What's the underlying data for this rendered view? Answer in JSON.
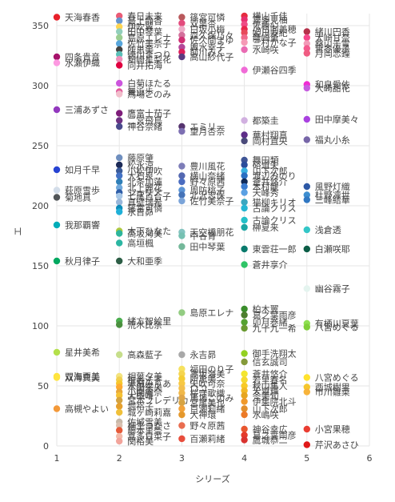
{
  "chart_data": {
    "type": "scatter",
    "xlabel": "シリーズ",
    "ylabel": "エ",
    "xlim": [
      1,
      6
    ],
    "ylim": [
      0,
      360
    ],
    "xticks": [
      1,
      2,
      3,
      4,
      5,
      6
    ],
    "yticks": [
      0,
      50,
      100,
      150,
      200,
      250,
      300,
      350
    ],
    "grid": true,
    "points": [
      {
        "x": 1,
        "y": 357,
        "label": "天海春香",
        "color": "#e8202a"
      },
      {
        "x": 1,
        "y": 324,
        "label": "四条貴音",
        "color": "#a6126a"
      },
      {
        "x": 1,
        "y": 319,
        "label": "水瀬伊織",
        "color": "#fd99e1"
      },
      {
        "x": 1,
        "y": 280,
        "label": "三浦あずさ",
        "color": "#9238be"
      },
      {
        "x": 1,
        "y": 230,
        "label": "如月千早",
        "color": "#2743d2"
      },
      {
        "x": 1,
        "y": 213,
        "label": "萩原雪歩",
        "color": "#d3dde9"
      },
      {
        "x": 1,
        "y": 207,
        "label": "菊地真",
        "color": "#515558"
      },
      {
        "x": 1,
        "y": 184,
        "label": "我那覇響",
        "color": "#01adb9"
      },
      {
        "x": 1,
        "y": 154,
        "label": "秋月律子",
        "color": "#01a860"
      },
      {
        "x": 1,
        "y": 78,
        "label": "星井美希",
        "color": "#b4e04b"
      },
      {
        "x": 1,
        "y": 58,
        "label": "双海亜美",
        "color": "#ffe43f"
      },
      {
        "x": 1,
        "y": 57,
        "label": "双海真美",
        "color": "#ffe43f"
      },
      {
        "x": 1,
        "y": 31,
        "label": "高槻やよい",
        "color": "#f39939"
      },
      {
        "x": 2,
        "y": 358,
        "label": "春日未来",
        "color": "#ea5b76"
      },
      {
        "x": 2,
        "y": 354,
        "label": "最上静香",
        "color": "#6495cf"
      },
      {
        "x": 2,
        "y": 349,
        "label": "伊吹翼",
        "color": "#fed552"
      },
      {
        "x": 2,
        "y": 345,
        "label": "田中琴葉",
        "color": "#92cfbb"
      },
      {
        "x": 2,
        "y": 340,
        "label": "島原エレナ",
        "color": "#9bce92"
      },
      {
        "x": 2,
        "y": 335,
        "label": "佐竹美奈子",
        "color": "#58a6dc"
      },
      {
        "x": 2,
        "y": 330,
        "label": "所恵美",
        "color": "#454341"
      },
      {
        "x": 2,
        "y": 326,
        "label": "徳川まつり",
        "color": "#5abfb7"
      },
      {
        "x": 2,
        "y": 322,
        "label": "箱崎星梨花",
        "color": "#ed90ba"
      },
      {
        "x": 2,
        "y": 317,
        "label": "向井拓海",
        "color": "#e0003f"
      },
      {
        "x": 2,
        "y": 302,
        "label": "白菊ほたる",
        "color": "#cc55dd"
      },
      {
        "x": 2,
        "y": 295,
        "label": "舞浜歩",
        "color": "#e25a9b"
      },
      {
        "x": 2,
        "y": 293,
        "label": "馬場このみ",
        "color": "#f1becb"
      },
      {
        "x": 2,
        "y": 277,
        "label": "鷹富士茄子",
        "color": "#7e1d7a"
      },
      {
        "x": 2,
        "y": 271,
        "label": "二宮飛鳥",
        "color": "#6e3182"
      },
      {
        "x": 2,
        "y": 266,
        "label": "神谷奈緒",
        "color": "#4a4a8c"
      },
      {
        "x": 2,
        "y": 240,
        "label": "藤原肇",
        "color": "#6f8fbf"
      },
      {
        "x": 2,
        "y": 234,
        "label": "松永涼",
        "color": "#1d2b58"
      },
      {
        "x": 2,
        "y": 229,
        "label": "小松伊吹",
        "color": "#3a5a98"
      },
      {
        "x": 2,
        "y": 225,
        "label": "大石泉",
        "color": "#4472c4"
      },
      {
        "x": 2,
        "y": 220,
        "label": "北条加蓮",
        "color": "#2f7fb8"
      },
      {
        "x": 2,
        "y": 215,
        "label": "北上麗花",
        "color": "#6fa8dc"
      },
      {
        "x": 2,
        "y": 211,
        "label": "ジュリア",
        "color": "#2e5da8"
      },
      {
        "x": 2,
        "y": 208,
        "label": "七尾百合子",
        "color": "#a7c7e7"
      },
      {
        "x": 2,
        "y": 203,
        "label": "真壁瑞希",
        "color": "#99b6d9"
      },
      {
        "x": 2,
        "y": 198,
        "label": "篠宮可憐",
        "color": "#0f8cb9"
      },
      {
        "x": 2,
        "y": 195,
        "label": "永吉昴",
        "color": "#1fb0d8"
      },
      {
        "x": 2,
        "y": 179,
        "label": "木下ひなた",
        "color": "#aec93f"
      },
      {
        "x": 2,
        "y": 177,
        "label": "高坂海美",
        "color": "#2db59c"
      },
      {
        "x": 2,
        "y": 169,
        "label": "高垣楓",
        "color": "#2bb6a2"
      },
      {
        "x": 2,
        "y": 154,
        "label": "大和亜季",
        "color": "#2d5e46"
      },
      {
        "x": 2,
        "y": 104,
        "label": "緒方智絵里",
        "color": "#4caf50"
      },
      {
        "x": 2,
        "y": 101,
        "label": "荒木比奈",
        "color": "#4a8f3e"
      },
      {
        "x": 2,
        "y": 76,
        "label": "高森藍子",
        "color": "#c6de8b"
      },
      {
        "x": 2,
        "y": 58,
        "label": "相葉夕美",
        "color": "#f3e37f"
      },
      {
        "x": 2,
        "y": 55,
        "label": "椎名法子",
        "color": "#f0d050"
      },
      {
        "x": 2,
        "y": 52,
        "label": "赤城みりあ",
        "color": "#f7c72d"
      },
      {
        "x": 2,
        "y": 49,
        "label": "本田未央",
        "color": "#ffaa30"
      },
      {
        "x": 2,
        "y": 45,
        "label": "小関麗奈",
        "color": "#e8a838"
      },
      {
        "x": 2,
        "y": 42,
        "label": "大槻唯",
        "color": "#f6c233"
      },
      {
        "x": 2,
        "y": 38,
        "label": "宮本フレデリカ",
        "color": "#d4a33f"
      },
      {
        "x": 2,
        "y": 33,
        "label": "堀裕子",
        "color": "#e5a02e"
      },
      {
        "x": 2,
        "y": 28,
        "label": "城ヶ崎莉嘉",
        "color": "#f0c03a"
      },
      {
        "x": 2,
        "y": 20,
        "label": "佐城雪美",
        "color": "#c7b8a8"
      },
      {
        "x": 2,
        "y": 17,
        "label": "桐生つかさ",
        "color": "#d9c0b0"
      },
      {
        "x": 2,
        "y": 13,
        "label": "藤本里奈",
        "color": "#e65a39"
      },
      {
        "x": 2,
        "y": 8,
        "label": "喜多日菜子",
        "color": "#f3b9a8"
      },
      {
        "x": 2,
        "y": 4,
        "label": "関裕美",
        "color": "#f2a49b"
      },
      {
        "x": 3,
        "y": 357,
        "label": "篠宮可憐",
        "color": "#b9595c"
      },
      {
        "x": 3,
        "y": 352,
        "label": "双葉杏",
        "color": "#e34a7d"
      },
      {
        "x": 3,
        "y": 347,
        "label": "白坂小梅",
        "color": "#eeaac7"
      },
      {
        "x": 3,
        "y": 342,
        "label": "森久保乃々",
        "color": "#d36f9b"
      },
      {
        "x": 3,
        "y": 338,
        "label": "佐久間まゆ",
        "color": "#d12f73"
      },
      {
        "x": 3,
        "y": 332,
        "label": "輿水幸子",
        "color": "#b3489a"
      },
      {
        "x": 3,
        "y": 328,
        "label": "前川みく",
        "color": "#dd1f5b"
      },
      {
        "x": 3,
        "y": 324,
        "label": "高山紗代子",
        "color": "#5c3a80"
      },
      {
        "x": 3,
        "y": 266,
        "label": "エミリー",
        "color": "#55346e"
      },
      {
        "x": 3,
        "y": 262,
        "label": "望月杏奈",
        "color": "#7d6fb2"
      },
      {
        "x": 3,
        "y": 233,
        "label": "豊川風花",
        "color": "#7d7db8"
      },
      {
        "x": 3,
        "y": 225,
        "label": "横山奈緒",
        "color": "#5468b1"
      },
      {
        "x": 3,
        "y": 220,
        "label": "野々原茜",
        "color": "#4a6cc0"
      },
      {
        "x": 3,
        "y": 213,
        "label": "周防桃子",
        "color": "#5b93d5"
      },
      {
        "x": 3,
        "y": 209,
        "label": "北沢志保",
        "color": "#4573b8"
      },
      {
        "x": 3,
        "y": 204,
        "label": "佐竹美奈子",
        "color": "#7ba4d9"
      },
      {
        "x": 3,
        "y": 178,
        "label": "天空橋朋花",
        "color": "#84c4c0"
      },
      {
        "x": 3,
        "y": 175,
        "label": "中谷育",
        "color": "#76c1b2"
      },
      {
        "x": 3,
        "y": 166,
        "label": "田中琴葉",
        "color": "#74b89a"
      },
      {
        "x": 3,
        "y": 111,
        "label": "島原エレナ",
        "color": "#93cc82"
      },
      {
        "x": 3,
        "y": 76,
        "label": "永吉昴",
        "color": "#a8a8a8"
      },
      {
        "x": 3,
        "y": 64,
        "label": "福田のり子",
        "color": "#f6e15f"
      },
      {
        "x": 3,
        "y": 60,
        "label": "高坂海美",
        "color": "#f5d54f"
      },
      {
        "x": 3,
        "y": 56,
        "label": "所恵美",
        "color": "#f4cd33"
      },
      {
        "x": 3,
        "y": 52,
        "label": "矢吹可奈",
        "color": "#f7c843"
      },
      {
        "x": 3,
        "y": 48,
        "label": "ロコ",
        "color": "#f3bf4c"
      },
      {
        "x": 3,
        "y": 44,
        "label": "桜守歌織",
        "color": "#f0b84a"
      },
      {
        "x": 3,
        "y": 40,
        "label": "馬場このみ",
        "color": "#e0a648"
      },
      {
        "x": 3,
        "y": 36,
        "label": "宮尾美也",
        "color": "#d6a343"
      },
      {
        "x": 3,
        "y": 31,
        "label": "百瀬莉緒",
        "color": "#f2a23a"
      },
      {
        "x": 3,
        "y": 26,
        "label": "大神環",
        "color": "#e4982d"
      },
      {
        "x": 3,
        "y": 17,
        "label": "野々原茜",
        "color": "#e96d50"
      },
      {
        "x": 3,
        "y": 6,
        "label": "百瀬莉緒",
        "color": "#e84d3c"
      },
      {
        "x": 4,
        "y": 358,
        "label": "横山千佳",
        "color": "#e62b3f"
      },
      {
        "x": 4,
        "y": 355,
        "label": "喜多見柚",
        "color": "#e72f6e"
      },
      {
        "x": 4,
        "y": 351,
        "label": "佐藤心",
        "color": "#ee4b85"
      },
      {
        "x": 4,
        "y": 347,
        "label": "小日向美穂",
        "color": "#e8254b"
      },
      {
        "x": 4,
        "y": 344,
        "label": "姫川友紀",
        "color": "#e74a5a"
      },
      {
        "x": 4,
        "y": 340,
        "label": "龍崎薫",
        "color": "#f06a8b"
      },
      {
        "x": 4,
        "y": 336,
        "label": "三村かな子",
        "color": "#f59ab6"
      },
      {
        "x": 4,
        "y": 330,
        "label": "水崎咲",
        "color": "#e96bb3"
      },
      {
        "x": 4,
        "y": 313,
        "label": "伊瀬谷四季",
        "color": "#f06bd7"
      },
      {
        "x": 4,
        "y": 271,
        "label": "都築圭",
        "color": "#d1b0e0"
      },
      {
        "x": 4,
        "y": 259,
        "label": "華村翔真",
        "color": "#5e2e88"
      },
      {
        "x": 4,
        "y": 254,
        "label": "岡村直央",
        "color": "#4a4a7a"
      },
      {
        "x": 4,
        "y": 238,
        "label": "舞田類",
        "color": "#3f5596"
      },
      {
        "x": 4,
        "y": 234,
        "label": "硲道夫",
        "color": "#2b4c9b"
      },
      {
        "x": 4,
        "y": 229,
        "label": "山下次郎",
        "color": "#39b0e0"
      },
      {
        "x": 4,
        "y": 225,
        "label": "渡辺みのり",
        "color": "#2b6fc2"
      },
      {
        "x": 4,
        "y": 220,
        "label": "蒼井悠介",
        "color": "#102a58"
      },
      {
        "x": 4,
        "y": 216,
        "label": "木村龍",
        "color": "#3b7bcf"
      },
      {
        "x": 4,
        "y": 211,
        "label": "天峰秀",
        "color": "#5aa0e3"
      },
      {
        "x": 4,
        "y": 203,
        "label": "猫柳キリオ",
        "color": "#3aa6c0"
      },
      {
        "x": 4,
        "y": 198,
        "label": "古論クリス",
        "color": "#25b5d3"
      },
      {
        "x": 4,
        "y": 188,
        "label": "古論クリス",
        "color": "#23c0c9"
      },
      {
        "x": 4,
        "y": 182,
        "label": "榊夏来",
        "color": "#1ba6a4"
      },
      {
        "x": 4,
        "y": 164,
        "label": "東雲荘一郎",
        "color": "#087a6c"
      },
      {
        "x": 4,
        "y": 151,
        "label": "蒼井享介",
        "color": "#2ec466"
      },
      {
        "x": 4,
        "y": 114,
        "label": "柏木翼",
        "color": "#3a8d2b"
      },
      {
        "x": 4,
        "y": 109,
        "label": "葛之葉雨彦",
        "color": "#4d7e2e"
      },
      {
        "x": 4,
        "y": 103,
        "label": "卯月巻緒",
        "color": "#55a230"
      },
      {
        "x": 4,
        "y": 98,
        "label": "九十九一希",
        "color": "#6a9a30"
      },
      {
        "x": 4,
        "y": 77,
        "label": "御手洗翔太",
        "color": "#93d121"
      },
      {
        "x": 4,
        "y": 70,
        "label": "信玄誠司",
        "color": "#859a3a"
      },
      {
        "x": 4,
        "y": 60,
        "label": "蒼井悠介",
        "color": "#f3e630"
      },
      {
        "x": 4,
        "y": 55,
        "label": "若里春名",
        "color": "#f6d930"
      },
      {
        "x": 4,
        "y": 50,
        "label": "秋山隼人",
        "color": "#f8ca26"
      },
      {
        "x": 4,
        "y": 46,
        "label": "天道輝",
        "color": "#f3b925"
      },
      {
        "x": 4,
        "y": 42,
        "label": "冬美旬",
        "color": "#e6a520"
      },
      {
        "x": 4,
        "y": 37,
        "label": "伊集院北斗",
        "color": "#f0992a"
      },
      {
        "x": 4,
        "y": 31,
        "label": "山下次郎",
        "color": "#e28f2c"
      },
      {
        "x": 4,
        "y": 26,
        "label": "水嶋咲",
        "color": "#ec7a28"
      },
      {
        "x": 4,
        "y": 14,
        "label": "神谷幸広",
        "color": "#e8562f"
      },
      {
        "x": 4,
        "y": 9,
        "label": "葛之葉雨彦",
        "color": "#e43a2b"
      },
      {
        "x": 4,
        "y": 5,
        "label": "鷹城恭二",
        "color": "#d9322f"
      },
      {
        "x": 5,
        "y": 345,
        "label": "緒川円香",
        "color": "#b5314a"
      },
      {
        "x": 5,
        "y": 340,
        "label": "大崎甘奈",
        "color": "#f6478a"
      },
      {
        "x": 5,
        "y": 335,
        "label": "桑山千雪",
        "color": "#f29ab7"
      },
      {
        "x": 5,
        "y": 331,
        "label": "黛冬優子",
        "color": "#f45a8f"
      },
      {
        "x": 5,
        "y": 327,
        "label": "月岡恋鐘",
        "color": "#f05c82"
      },
      {
        "x": 5,
        "y": 301,
        "label": "和泉愛依",
        "color": "#f12bd2"
      },
      {
        "x": 5,
        "y": 298,
        "label": "大崎甜花",
        "color": "#c65de0"
      },
      {
        "x": 5,
        "y": 272,
        "label": "田中摩美々",
        "color": "#a941e0"
      },
      {
        "x": 5,
        "y": 255,
        "label": "福丸小糸",
        "color": "#7766a8"
      },
      {
        "x": 5,
        "y": 216,
        "label": "風野灯織",
        "color": "#2d58a5"
      },
      {
        "x": 5,
        "y": 209,
        "label": "杜野凛世",
        "color": "#3e8ed0"
      },
      {
        "x": 5,
        "y": 205,
        "label": "三峰結華",
        "color": "#3077c2"
      },
      {
        "x": 5,
        "y": 180,
        "label": "浅倉透",
        "color": "#33c6c7"
      },
      {
        "x": 5,
        "y": 164,
        "label": "白瀬咲耶",
        "color": "#0b5d46"
      },
      {
        "x": 5,
        "y": 131,
        "label": "幽谷霧子",
        "color": "#e4f4ef"
      },
      {
        "x": 5,
        "y": 102,
        "label": "有栖川夏葉",
        "color": "#8fe053"
      },
      {
        "x": 5,
        "y": 99,
        "label": "八宮めぐる",
        "color": "#7fcf3a"
      },
      {
        "x": 5,
        "y": 57,
        "label": "八宮めぐる",
        "color": "#ffe22e"
      },
      {
        "x": 5,
        "y": 49,
        "label": "西城樹里",
        "color": "#f5c62c"
      },
      {
        "x": 5,
        "y": 45,
        "label": "市川雛菜",
        "color": "#f7b33a"
      },
      {
        "x": 5,
        "y": 14,
        "label": "小宮果穂",
        "color": "#ea3d32"
      },
      {
        "x": 5,
        "y": 1,
        "label": "芹沢あさひ",
        "color": "#e01818"
      }
    ]
  }
}
